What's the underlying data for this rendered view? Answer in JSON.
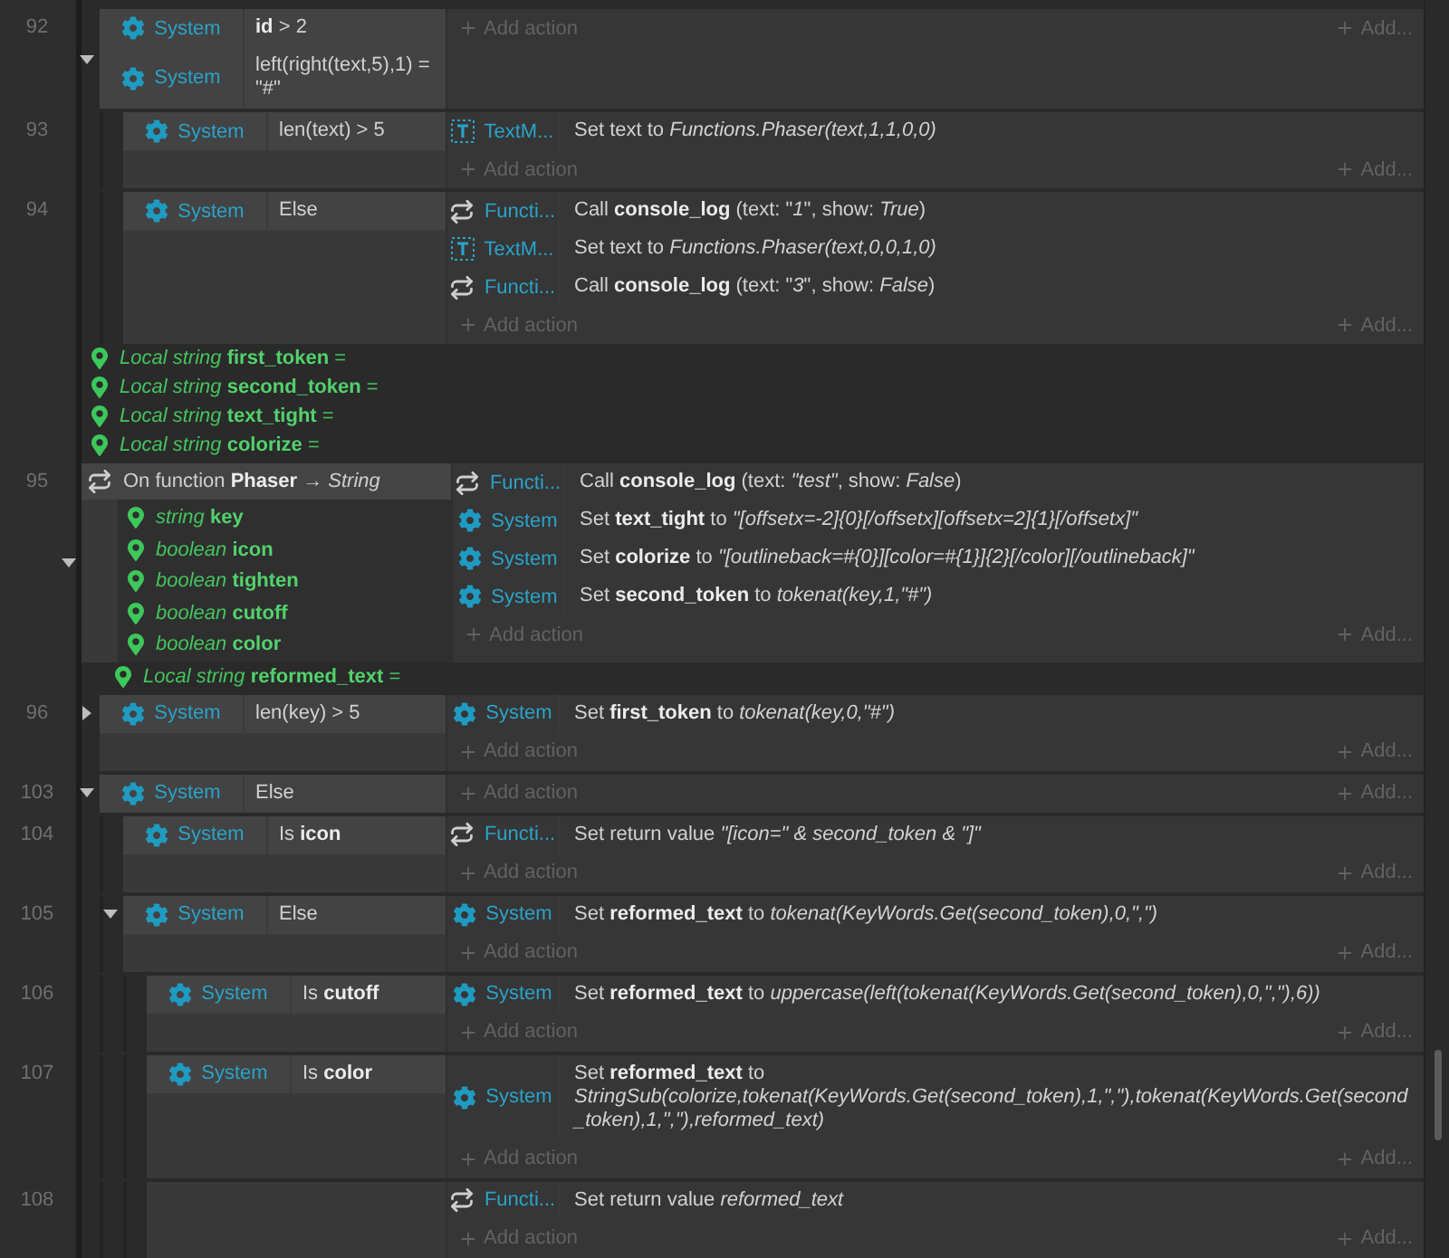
{
  "sheet": [
    {
      "kind": "parent",
      "children": [
        {
          "kind": "event",
          "number": "92",
          "expanded": true,
          "conditions": [
            {
              "kind": "system",
              "object": "System",
              "text": "**id** > 2"
            },
            {
              "kind": "system",
              "object": "System",
              "text": "left(right(text,5),1) = \"#\""
            }
          ],
          "add_action": "Add action",
          "add_more": "Add...",
          "children": [
            {
              "kind": "event",
              "number": "93",
              "conditions": [
                {
                  "kind": "system",
                  "object": "System",
                  "text": "len(text) > 5"
                }
              ],
              "actions": [
                {
                  "kind": "text",
                  "object": "TextM...",
                  "text": "Set text to *Functions.Phaser(text,1,1,0,0)*"
                }
              ],
              "add_action": "Add action",
              "add_more": "Add..."
            },
            {
              "kind": "event",
              "number": "94",
              "conditions": [
                {
                  "kind": "system",
                  "object": "System",
                  "text": "Else"
                }
              ],
              "actions": [
                {
                  "kind": "function",
                  "object": "Functi...",
                  "text": "Call **console_log** (text: \"*1*\", show: *True*)"
                },
                {
                  "kind": "text",
                  "object": "TextM...",
                  "text": "Set text to *Functions.Phaser(text,0,0,1,0)*"
                },
                {
                  "kind": "function",
                  "object": "Functi...",
                  "text": "Call **console_log** (text: \"*3*\", show: *False*)"
                }
              ],
              "add_action": "Add action",
              "add_more": "Add..."
            }
          ]
        }
      ]
    },
    {
      "kind": "local",
      "text": "*Local string* **first_token** ="
    },
    {
      "kind": "local",
      "text": "*Local string* **second_token** ="
    },
    {
      "kind": "local",
      "text": "*Local string* **text_tight** ="
    },
    {
      "kind": "local",
      "text": "*Local string* **colorize** ="
    },
    {
      "kind": "function",
      "number": "95",
      "expanded": true,
      "header": "On function **Phaser** → *String*",
      "params": [
        {
          "text": "*string* **key**"
        },
        {
          "text": "*boolean* **icon**"
        },
        {
          "text": "*boolean* **tighten**"
        },
        {
          "text": "*boolean* **cutoff**"
        },
        {
          "text": "*boolean* **color**"
        }
      ],
      "actions": [
        {
          "kind": "function",
          "object": "Functi...",
          "text": "Call **console_log** (text: *\"test\"*, show: *False*)"
        },
        {
          "kind": "system",
          "object": "System",
          "text": "Set **text_tight** to *\"[offsetx=-2]{0}[/offsetx][offsetx=2]{1}[/offsetx]\"*"
        },
        {
          "kind": "system",
          "object": "System",
          "text": "Set **colorize** to *\"[outlineback=#{0}][color=#{1}]{2}[/color][/outlineback]\"*"
        },
        {
          "kind": "system",
          "object": "System",
          "text": "Set **second_token** to *tokenat(key,1,\"#\")*"
        }
      ],
      "add_action": "Add action",
      "add_more": "Add...",
      "children": [
        {
          "kind": "local",
          "text": "*Local string* **reformed_text** ="
        },
        {
          "kind": "event",
          "number": "96",
          "expanded": false,
          "conditions": [
            {
              "kind": "system",
              "object": "System",
              "text": "len(key) > 5"
            }
          ],
          "actions": [
            {
              "kind": "system",
              "object": "System",
              "text": "Set **first_token** to *tokenat(key,0,\"#\")*"
            }
          ],
          "add_action": "Add action",
          "add_more": "Add..."
        },
        {
          "kind": "event",
          "number": "103",
          "expanded": true,
          "conditions": [
            {
              "kind": "system",
              "object": "System",
              "text": "Else"
            }
          ],
          "add_action": "Add action",
          "add_more": "Add...",
          "children": [
            {
              "kind": "event",
              "number": "104",
              "conditions": [
                {
                  "kind": "system",
                  "object": "System",
                  "text": "Is **icon**"
                }
              ],
              "actions": [
                {
                  "kind": "function",
                  "object": "Functi...",
                  "text": "Set return value *\"[icon=\" & second_token & \"]\"*"
                }
              ],
              "add_action": "Add action",
              "add_more": "Add..."
            },
            {
              "kind": "event",
              "number": "105",
              "expanded": true,
              "conditions": [
                {
                  "kind": "system",
                  "object": "System",
                  "text": "Else"
                }
              ],
              "actions": [
                {
                  "kind": "system",
                  "object": "System",
                  "text": "Set **reformed_text** to *tokenat(KeyWords.Get(second_token),0,\",\")*"
                }
              ],
              "add_action": "Add action",
              "add_more": "Add...",
              "children": [
                {
                  "kind": "event",
                  "number": "106",
                  "conditions": [
                    {
                      "kind": "system",
                      "object": "System",
                      "text": "Is **cutoff**"
                    }
                  ],
                  "actions": [
                    {
                      "kind": "system",
                      "object": "System",
                      "text": "Set **reformed_text** to *uppercase(left(tokenat(KeyWords.Get(second_token),0,\",\"),6))*"
                    }
                  ],
                  "add_action": "Add action",
                  "add_more": "Add..."
                },
                {
                  "kind": "event",
                  "number": "107",
                  "conditions": [
                    {
                      "kind": "system",
                      "object": "System",
                      "text": "Is **color**"
                    }
                  ],
                  "actions": [
                    {
                      "kind": "system",
                      "object": "System",
                      "text": "Set **reformed_text** to *StringSub(colorize,tokenat(KeyWords.Get(second_token),1,\",\"),tokenat(KeyWords.Get(second_token),1,\",\"),reformed_text)*"
                    }
                  ],
                  "add_action": "Add action",
                  "add_more": "Add..."
                },
                {
                  "kind": "event",
                  "number": "108",
                  "actions": [
                    {
                      "kind": "function",
                      "object": "Functi...",
                      "text": "Set return value *reformed_text*"
                    }
                  ],
                  "add_action": "Add action",
                  "add_more": "Add..."
                }
              ]
            }
          ]
        }
      ]
    }
  ]
}
